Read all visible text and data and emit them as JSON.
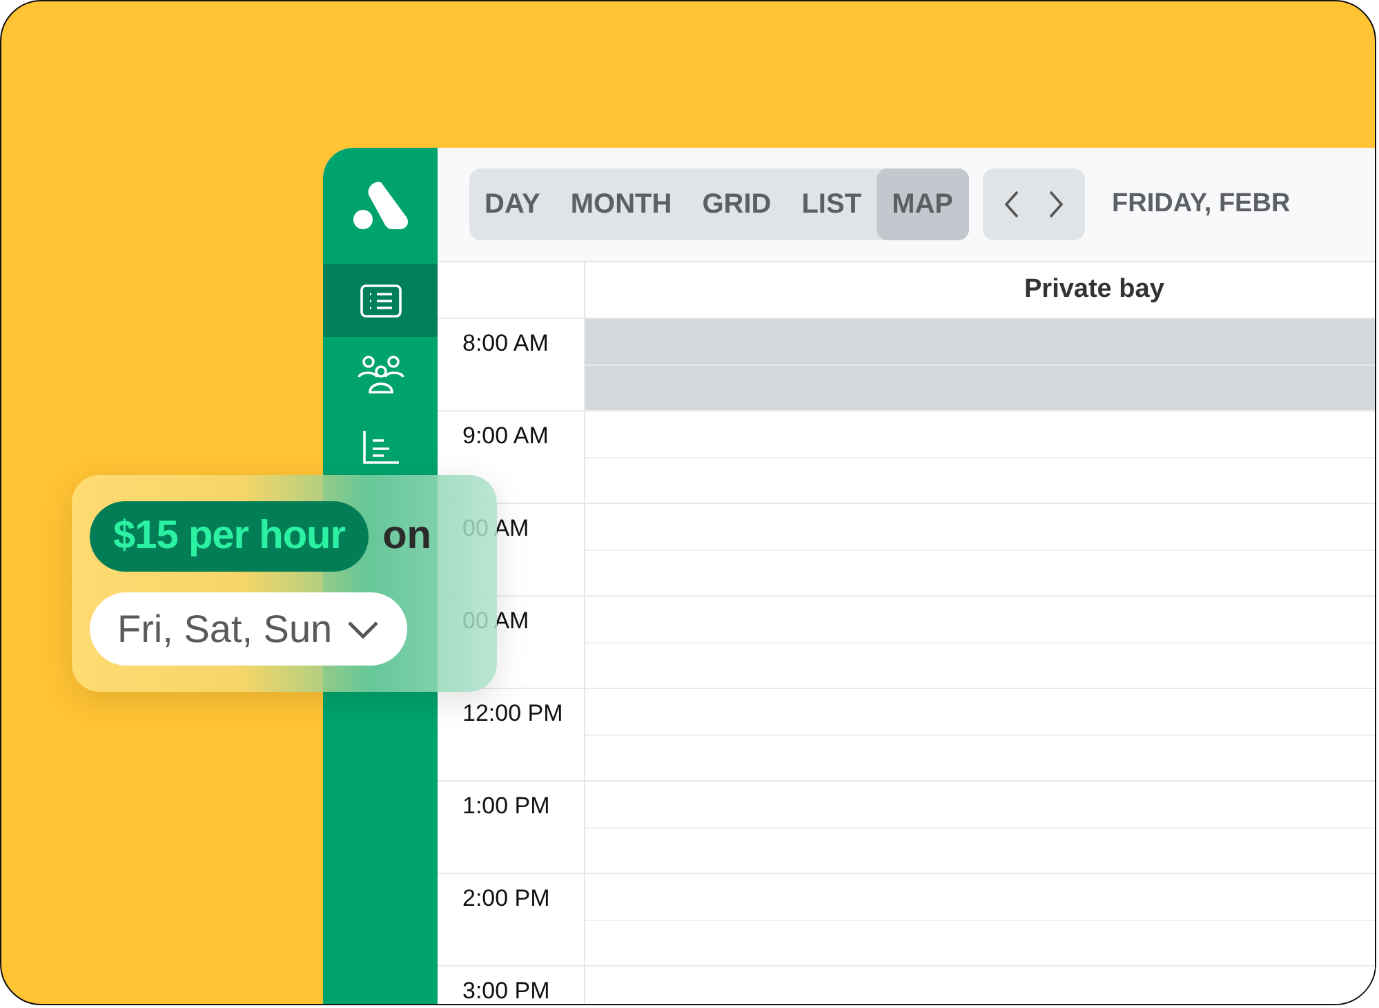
{
  "sidebar": {
    "items": [
      {
        "kind": "list",
        "selected": true
      },
      {
        "kind": "people",
        "selected": false
      },
      {
        "kind": "chart",
        "selected": false
      }
    ]
  },
  "toolbar": {
    "views": [
      {
        "label": "DAY",
        "selected": false
      },
      {
        "label": "MONTH",
        "selected": false
      },
      {
        "label": "GRID",
        "selected": false
      },
      {
        "label": "LIST",
        "selected": false
      },
      {
        "label": "MAP",
        "selected": true
      }
    ],
    "date": "FRIDAY, FEBR"
  },
  "calendar": {
    "column": "Private bay",
    "rows": [
      {
        "time": "8:00 AM",
        "booked": true
      },
      {
        "time": "9:00 AM",
        "booked": false
      },
      {
        "time": "00 AM",
        "booked": false
      },
      {
        "time": "00 AM",
        "booked": false
      },
      {
        "time": "12:00 PM",
        "booked": false
      },
      {
        "time": "1:00 PM",
        "booked": false
      },
      {
        "time": "2:00 PM",
        "booked": false
      },
      {
        "time": "3:00 PM",
        "booked": false
      }
    ]
  },
  "promo": {
    "price": "$15 per hour",
    "joiner": "on",
    "days": "Fri, Sat, Sun"
  }
}
